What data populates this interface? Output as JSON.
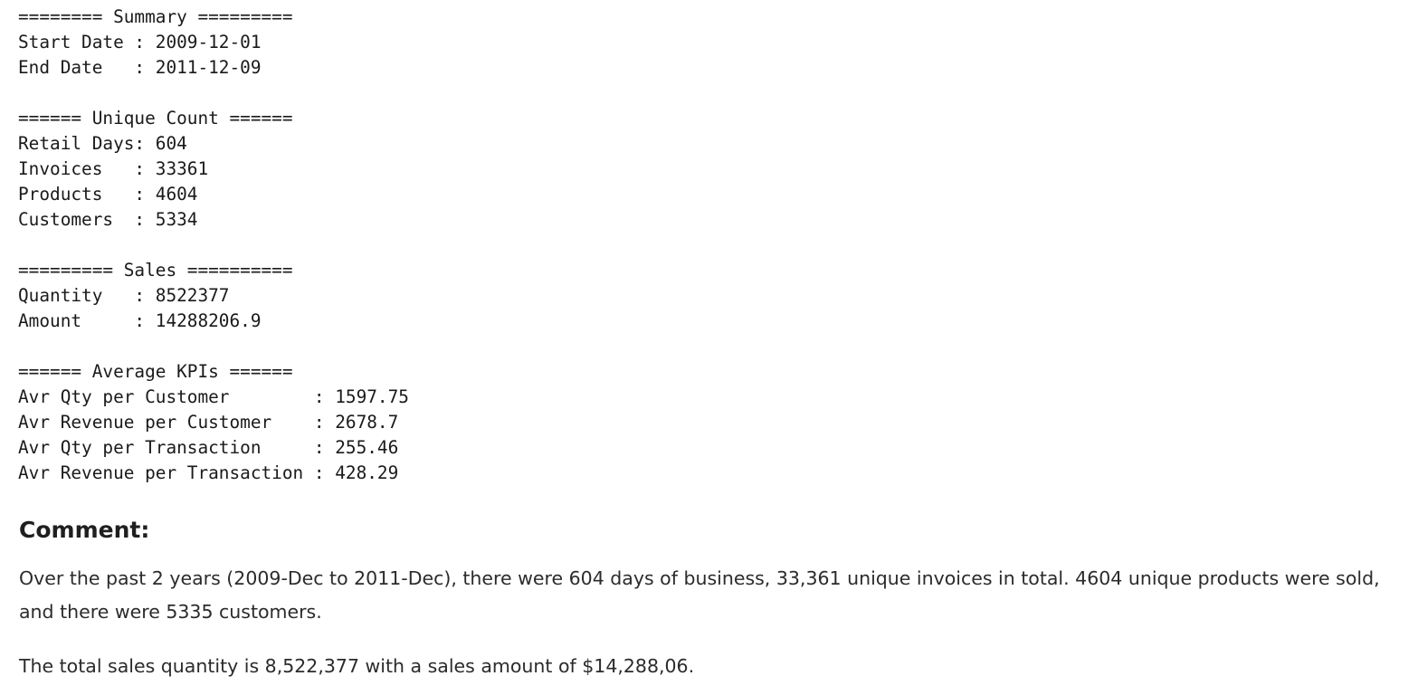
{
  "output": {
    "lines": [
      "======== Summary =========",
      "Start Date : 2009-12-01",
      "End Date   : 2011-12-09",
      "",
      "====== Unique Count ======",
      "Retail Days: 604",
      "Invoices   : 33361",
      "Products   : 4604",
      "Customers  : 5334",
      "",
      "========= Sales ==========",
      "Quantity   : 8522377",
      "Amount     : 14288206.9",
      "",
      "====== Average KPIs ======",
      "Avr Qty per Customer        : 1597.75",
      "Avr Revenue per Customer    : 2678.7",
      "Avr Qty per Transaction     : 255.46",
      "Avr Revenue per Transaction : 428.29"
    ]
  },
  "markdown": {
    "heading": "Comment:",
    "paragraph_1": "Over the past 2 years (2009-Dec to 2011-Dec), there were 604 days of business, 33,361 unique invoices in total. 4604 unique products were sold, and there were 5335 customers.",
    "paragraph_2": "The total sales quantity is 8,522,377 with a sales amount of $14,288,06."
  }
}
